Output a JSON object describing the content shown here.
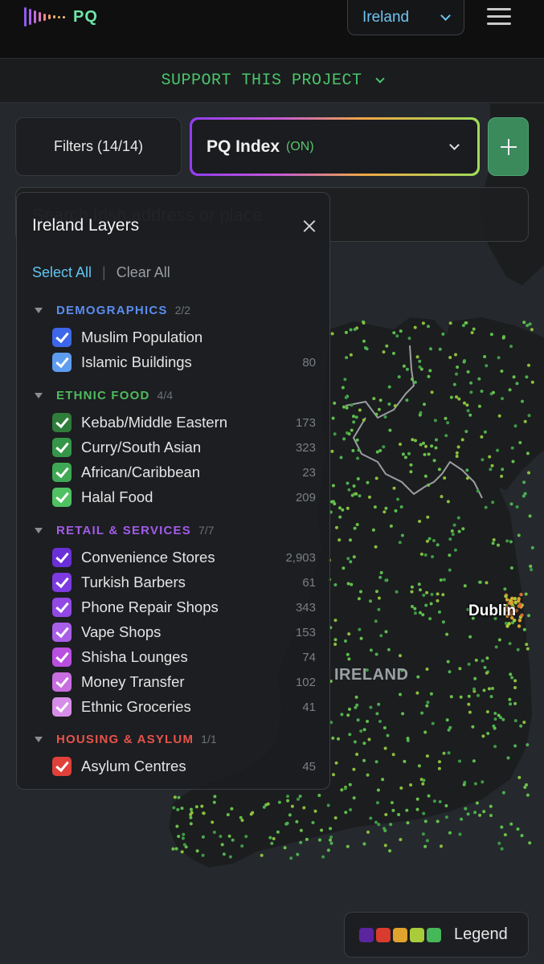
{
  "brand": {
    "name": "PQ",
    "bar_colors": [
      "#8a5cf0",
      "#a764e8",
      "#c46adc",
      "#dd76b8",
      "#ef8a86",
      "#f4a064",
      "#f4b060",
      "#f0bf6a",
      "#eac87a"
    ]
  },
  "header": {
    "country": "Ireland"
  },
  "support": {
    "label": "SUPPORT THIS PROJECT"
  },
  "controls": {
    "filters_label": "Filters (14/14)",
    "index_title": "PQ Index",
    "index_state": "(ON)"
  },
  "search": {
    "placeholder": "Search Irish address or place"
  },
  "panel": {
    "title": "Ireland Layers",
    "select_all": "Select All",
    "separator": "|",
    "clear_all": "Clear All",
    "groups": [
      {
        "name": "DEMOGRAPHICS",
        "count": "2/2",
        "color": "#5b8df0",
        "items": [
          {
            "label": "Muslim Population",
            "count": "",
            "color": "#3d67e8"
          },
          {
            "label": "Islamic Buildings",
            "count": "80",
            "color": "#5e9cf0"
          }
        ]
      },
      {
        "name": "ETHNIC FOOD",
        "count": "4/4",
        "color": "#4fbb5e",
        "items": [
          {
            "label": "Kebab/Middle Eastern",
            "count": "173",
            "color": "#2e7d3a"
          },
          {
            "label": "Curry/South Asian",
            "count": "323",
            "color": "#35964a"
          },
          {
            "label": "African/Caribbean",
            "count": "23",
            "color": "#3fa854"
          },
          {
            "label": "Halal Food",
            "count": "209",
            "color": "#4fc162"
          }
        ]
      },
      {
        "name": "RETAIL & SERVICES",
        "count": "7/7",
        "color": "#a35be8",
        "items": [
          {
            "label": "Convenience Stores",
            "count": "2,903",
            "color": "#6a30d8"
          },
          {
            "label": "Turkish Barbers",
            "count": "61",
            "color": "#7c3ae0"
          },
          {
            "label": "Phone Repair Shops",
            "count": "343",
            "color": "#9148e4"
          },
          {
            "label": "Vape Shops",
            "count": "153",
            "color": "#a95ee8"
          },
          {
            "label": "Shisha Lounges",
            "count": "74",
            "color": "#b94fe0"
          },
          {
            "label": "Money Transfer",
            "count": "102",
            "color": "#c86ee0"
          },
          {
            "label": "Ethnic Groceries",
            "count": "41",
            "color": "#d68de8"
          }
        ]
      },
      {
        "name": "HOUSING & ASYLUM",
        "count": "1/1",
        "color": "#e8534a",
        "items": [
          {
            "label": "Asylum Centres",
            "count": "45",
            "color": "#e0403a"
          }
        ]
      }
    ]
  },
  "map": {
    "labels": {
      "city": "Dublin",
      "country": "IRELAND"
    }
  },
  "legend": {
    "label": "Legend",
    "swatches": [
      "#5b25a0",
      "#d93b2f",
      "#e0a32e",
      "#a8cc3a",
      "#46b85a"
    ]
  }
}
